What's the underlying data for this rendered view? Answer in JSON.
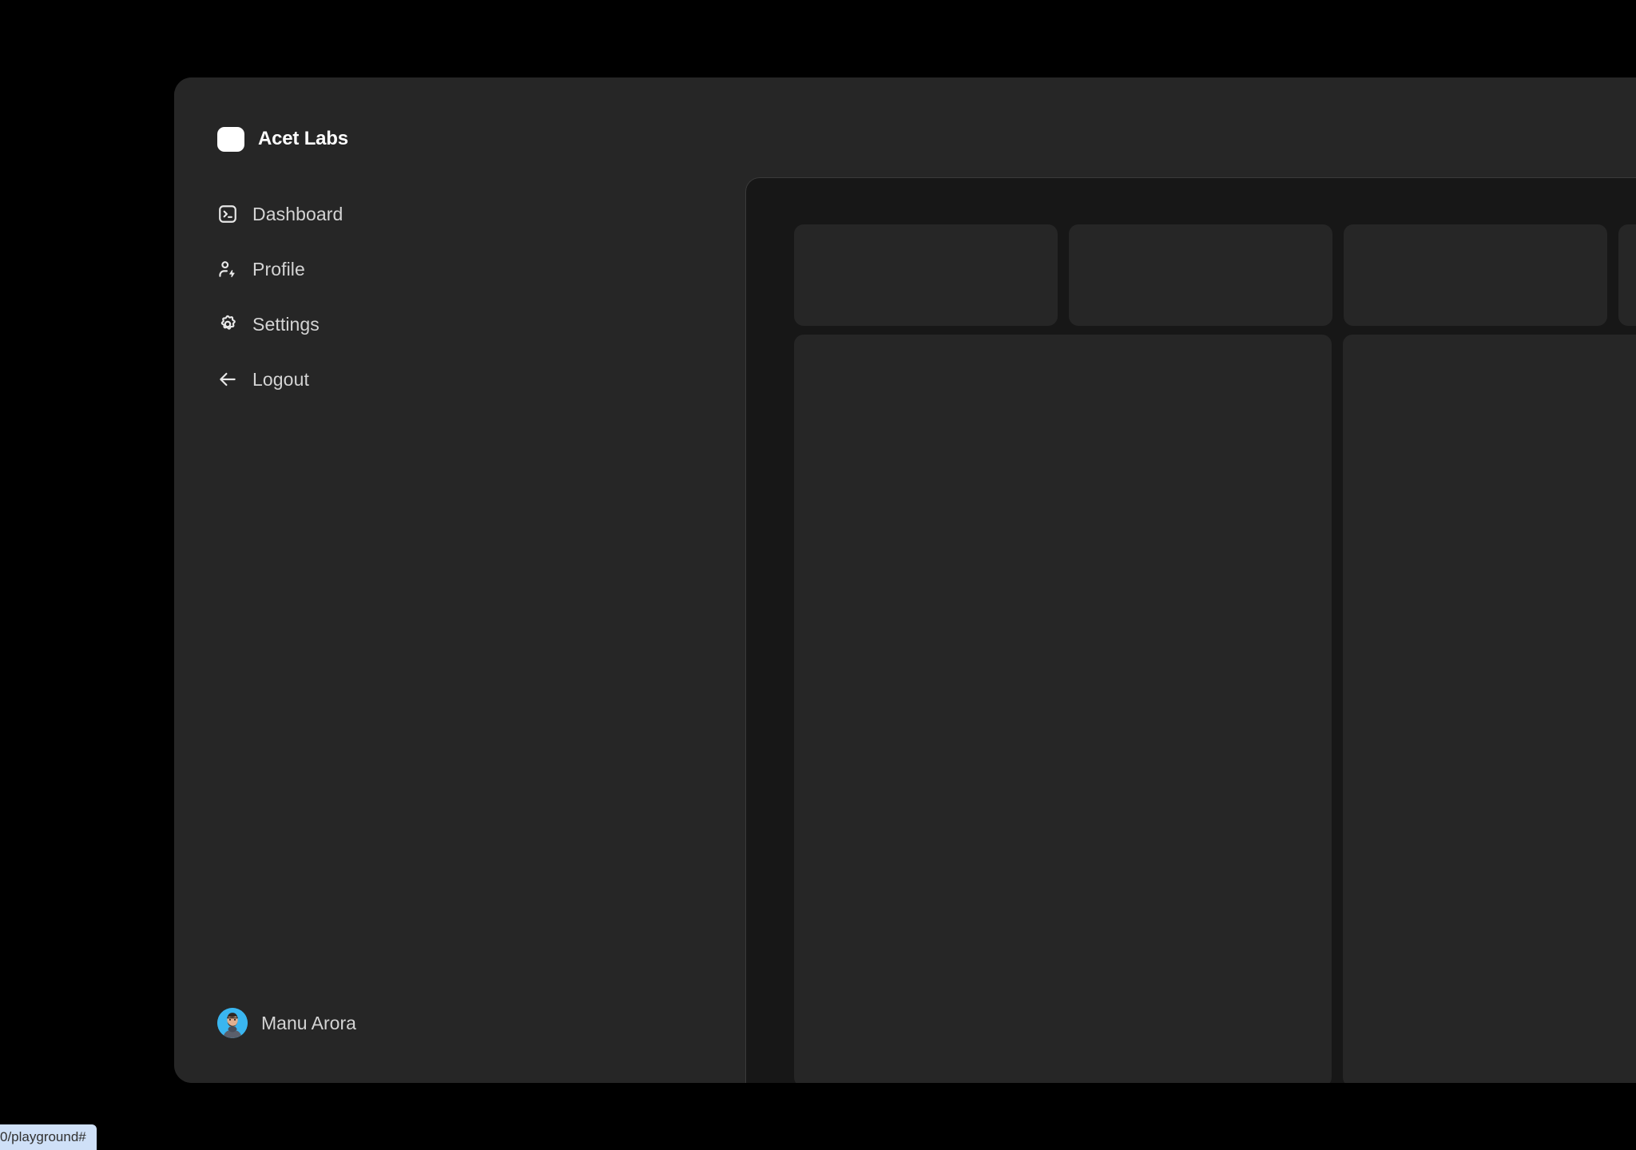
{
  "brand": {
    "name": "Acet Labs",
    "logo_icon": "rounded-square-logo",
    "logo_color": "#ffffff"
  },
  "sidebar": {
    "background_color": "#262626",
    "items": [
      {
        "label": "Dashboard",
        "icon": "square-terminal-icon"
      },
      {
        "label": "Profile",
        "icon": "user-bolt-icon"
      },
      {
        "label": "Settings",
        "icon": "gear-icon"
      },
      {
        "label": "Logout",
        "icon": "arrow-left-icon"
      }
    ],
    "user": {
      "name": "Manu Arora",
      "avatar_icon": "user-avatar-photo",
      "avatar_background": "#3ab6f0"
    }
  },
  "dashboard": {
    "background_color": "#171717",
    "card_color": "#262626",
    "stat_cards": [
      {
        "id": "stat-card-1"
      },
      {
        "id": "stat-card-2"
      },
      {
        "id": "stat-card-3"
      },
      {
        "id": "stat-card-4"
      }
    ],
    "panel_cards": [
      {
        "id": "panel-card-1"
      },
      {
        "id": "panel-card-2"
      }
    ]
  },
  "status_bar": {
    "url_text": "0/playground#"
  }
}
